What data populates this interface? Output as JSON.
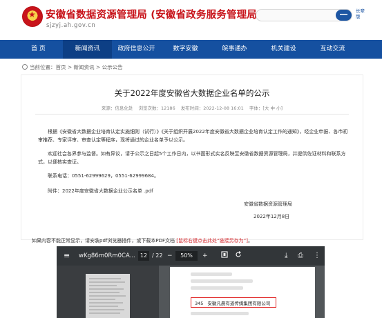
{
  "header": {
    "site_title": "安徽省数据资源管理局 (安徽省政务服务管理局)",
    "site_domain": "sjzyj.ah.gov.cn",
    "search_placeholder": "",
    "search_button": "━━",
    "elder_link": "长辈版"
  },
  "nav": {
    "items": [
      {
        "label": "首 页",
        "active": false
      },
      {
        "label": "新闻资讯",
        "active": true
      },
      {
        "label": "政府信息公开",
        "active": false
      },
      {
        "label": "数字安徽",
        "active": false
      },
      {
        "label": "皖事通办",
        "active": false
      },
      {
        "label": "机关建设",
        "active": false
      },
      {
        "label": "互动交流",
        "active": false
      }
    ]
  },
  "breadcrumb": "当前位置：首页 > 新闻资讯 > 公示公告",
  "article": {
    "title": "关于2022年度安徽省大数据企业名单的公示",
    "meta": {
      "source": "来源：信息化处",
      "views": "浏览次数：12186",
      "date": "发布时间：2022-12-08 16:01",
      "font": "字体：[大 中 小]"
    },
    "paragraphs": [
      "根据《安徽省大数据企业培育认定实施细则（试行）》《关于组织开展2022年度安徽省大数据企业培育认定工作的通知》，经企业申报、各市初审推荐、专家评审、审查认定等程序，现将通过的企业名单予以公示。",
      "欢迎社会各界参与监督。如有异议，请于公示之日起5个工作日内，以书面形式实名反映至安徽省数据资源管理局，并提供佐证材料和联系方式，以便核实查证。",
      "联系电话：0551-62999629，0551-62999684。",
      "附件：2022年度安徽省大数据企业公示名单 .pdf"
    ],
    "signature_org": "安徽省数据资源管理局",
    "signature_date": "2022年12月8日"
  },
  "pdf_note": {
    "text": "如果内容不能正常显示，请安装pdf浏览器插件，或下载本PDF文档 ",
    "link": "[鼠标右键点击此处“链接另存为”]",
    "tail": "。"
  },
  "pdf_viewer": {
    "filename": "wKg86m0Rm0CA...",
    "page_current": "12",
    "page_total": "/ 22",
    "zoom": "50%",
    "menu_icon": "≡",
    "minus": "−",
    "plus": "+",
    "download_icon": "⤓",
    "print_icon": "⎙",
    "more_icon": "⋮",
    "highlight_num": "345",
    "highlight_name": "安徽凡晨有道传媒集团有限公司"
  }
}
